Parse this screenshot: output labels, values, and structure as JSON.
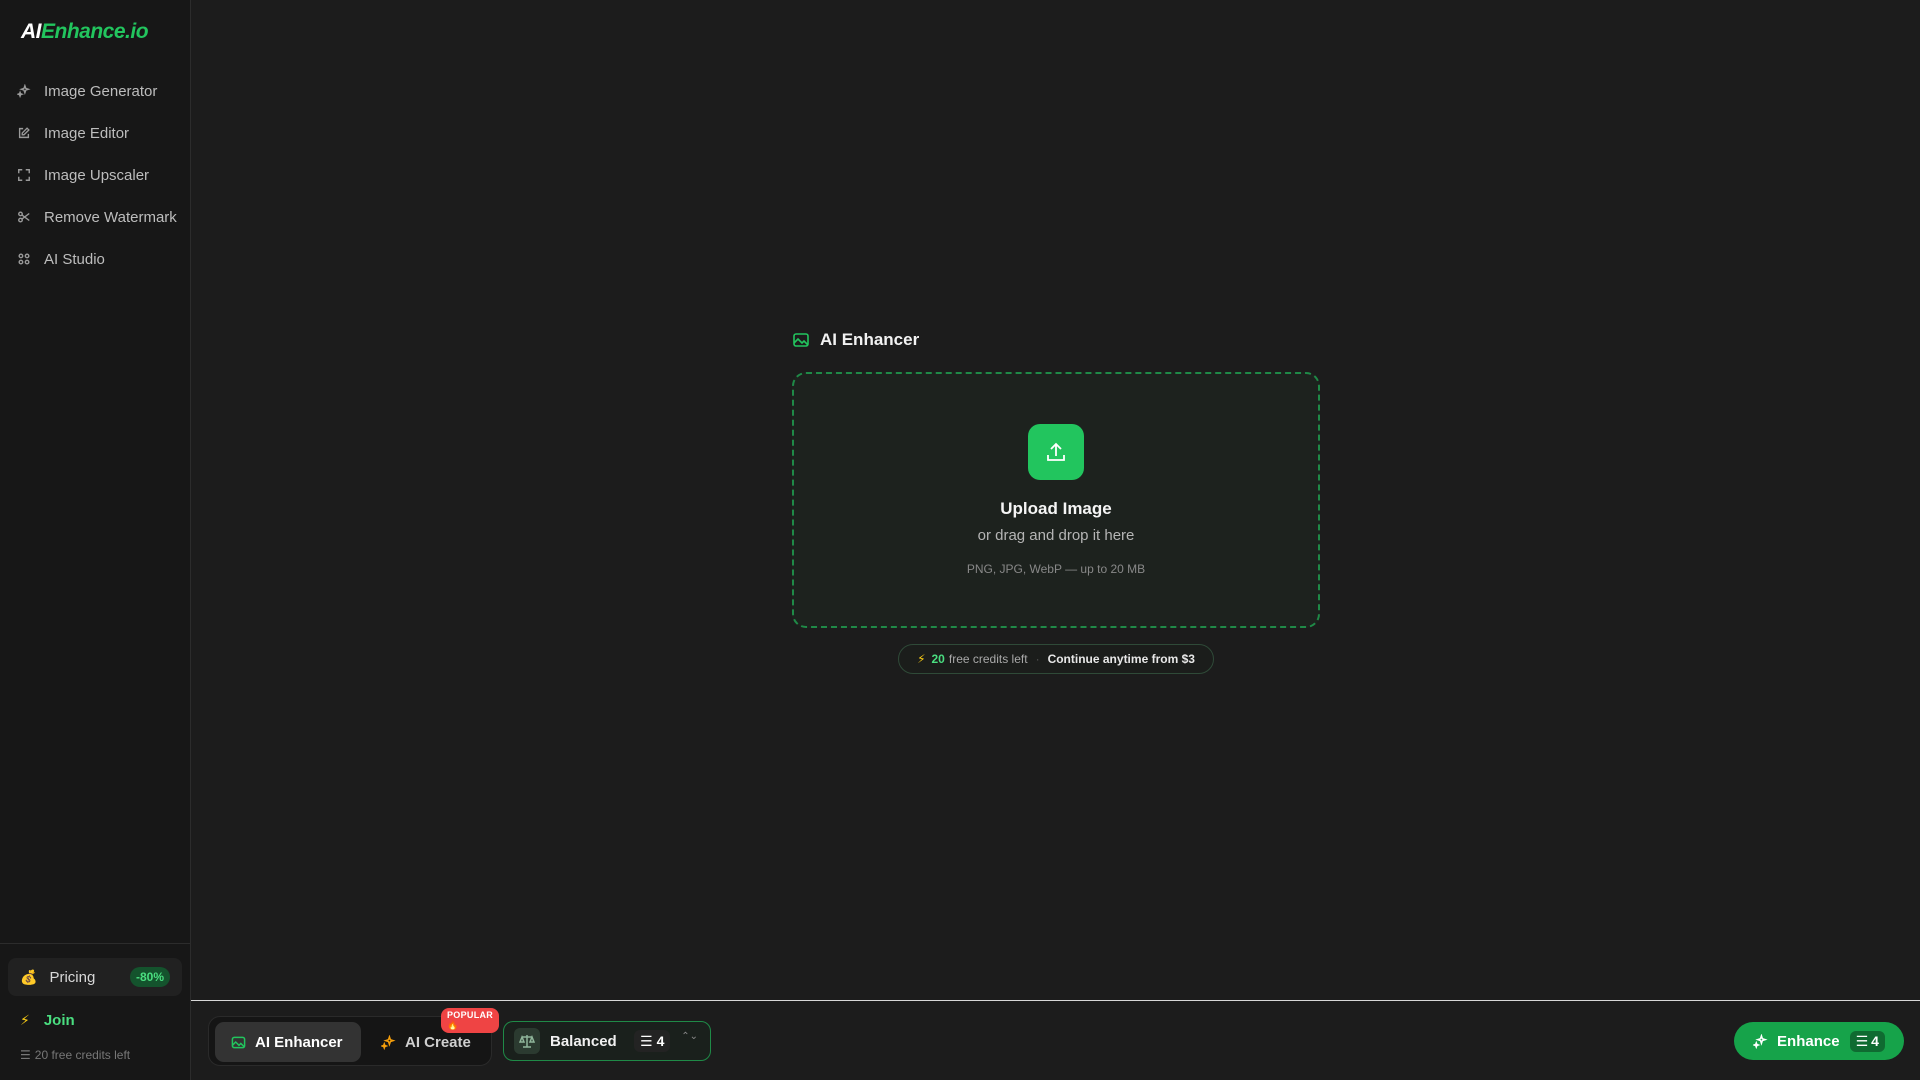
{
  "brand": {
    "logo_ai": "AI",
    "logo_rest": "Enhance.io"
  },
  "sidebar": {
    "items": [
      {
        "label": "Image Generator",
        "icon": "sparkles-icon"
      },
      {
        "label": "Image Editor",
        "icon": "edit-icon"
      },
      {
        "label": "Image Upscaler",
        "icon": "expand-icon"
      },
      {
        "label": "Remove Watermark",
        "icon": "scissors-icon"
      },
      {
        "label": "AI Studio",
        "icon": "grid-icon"
      }
    ],
    "footer": {
      "pricing_label": "Pricing",
      "pricing_emoji": "💰",
      "pricing_badge": "-80%",
      "join_label": "Join",
      "join_icon": "⚡",
      "credits_icon": "☰",
      "credits_text": "20 free credits left"
    }
  },
  "main": {
    "section_title": "AI Enhancer",
    "upload": {
      "title": "Upload Image",
      "subtitle": "or drag and drop it here",
      "formats": "PNG, JPG, WebP — up to 20 MB"
    },
    "credits_pill": {
      "bolt": "⚡",
      "count": "20",
      "text": "free credits left",
      "separator": "·",
      "cta": "Continue anytime from $3"
    }
  },
  "bottom_bar": {
    "modes": [
      {
        "label": "AI Enhancer",
        "active": true
      },
      {
        "label": "AI Create",
        "active": false
      }
    ],
    "popular_badge": "POPULAR 🔥",
    "quality": {
      "label": "Balanced",
      "cost_icon": "☰",
      "cost": "4",
      "chevron": "⌃⌄"
    },
    "enhance": {
      "label": "Enhance",
      "cost_icon": "☰",
      "cost": "4"
    }
  },
  "colors": {
    "accent": "#22c55e",
    "background": "#1c1c1c",
    "sidebar": "#171717"
  }
}
